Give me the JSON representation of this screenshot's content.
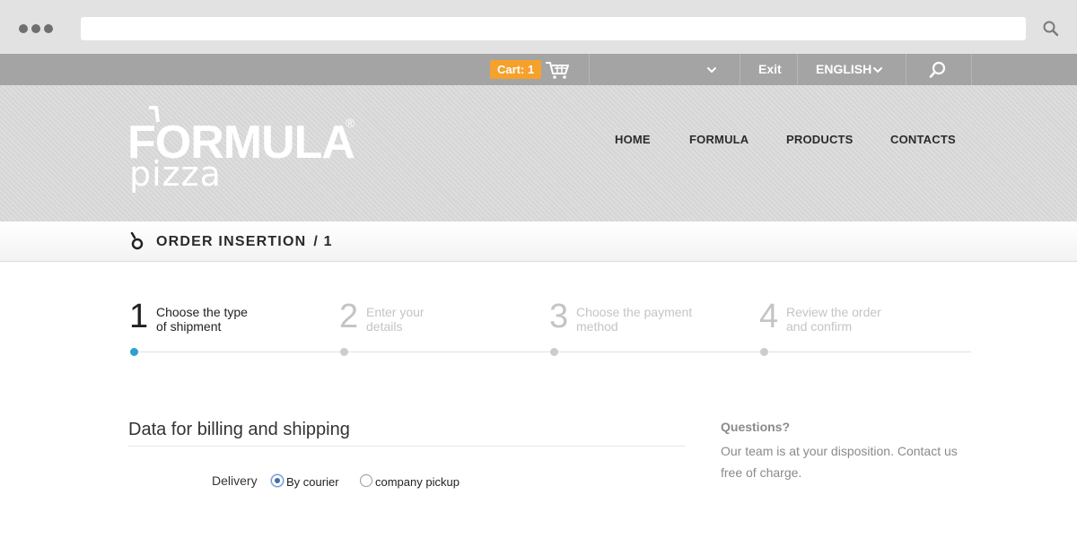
{
  "browser": {
    "url": ""
  },
  "topbar": {
    "cart_label": "Cart: 1",
    "exit_label": "Exit",
    "language_label": "ENGLISH"
  },
  "header": {
    "logo_brand": "FORMULA",
    "logo_sub": "pizza",
    "logo_reg": "®",
    "nav": [
      "HOME",
      "FORMULA",
      "PRODUCTS",
      "CONTACTS"
    ]
  },
  "titlebar": {
    "title": "ORDER INSERTION",
    "page": "/ 1"
  },
  "steps": [
    {
      "num": "1",
      "line1": "Choose the type",
      "line2": "of shipment",
      "active": true
    },
    {
      "num": "2",
      "line1": "Enter your",
      "line2": "details",
      "active": false
    },
    {
      "num": "3",
      "line1": "Choose the payment",
      "line2": "method",
      "active": false
    },
    {
      "num": "4",
      "line1": "Review the order",
      "line2": "and confirm",
      "active": false
    }
  ],
  "billing": {
    "title": "Data for billing and shipping",
    "delivery_label": "Delivery",
    "options": [
      "By courier",
      "company pickup"
    ],
    "selected": "By courier"
  },
  "questions": {
    "title": "Questions?",
    "text": "Our team is at your disposition. Contact us free of charge."
  },
  "colors": {
    "accent_orange": "#f6a12b",
    "step_active_dot": "#2aa2d0"
  }
}
